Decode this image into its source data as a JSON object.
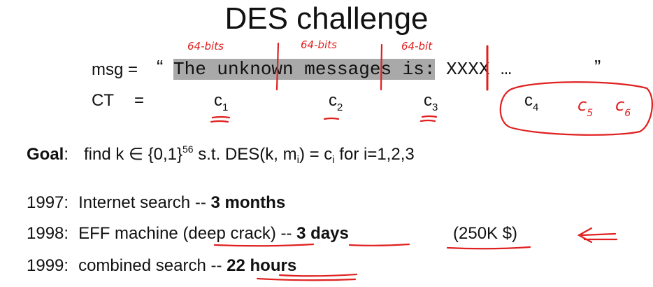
{
  "title": "DES challenge",
  "msg": {
    "label": "msg =",
    "open_quote": "“",
    "highlighted_text": "The unknown messages is:",
    "rest_text": " XXXX … ",
    "close_quote": "”"
  },
  "ct": {
    "label": "CT",
    "eq": "=",
    "blocks": [
      {
        "letter": "c",
        "sub": "1"
      },
      {
        "letter": "c",
        "sub": "2"
      },
      {
        "letter": "c",
        "sub": "3"
      },
      {
        "letter": "c",
        "sub": "4"
      }
    ]
  },
  "goal": {
    "label": "Goal",
    "colon": ":",
    "text1": "find   k ∈ {0,1}",
    "sup": "56",
    "text2": "   s.t.   DES(k, m",
    "sub_i": "i",
    "text3": ") = c",
    "sub_i2": "i",
    "text4": "   for  i=1,2,3"
  },
  "history": [
    {
      "year": "1997:",
      "desc": "Internet search  --  ",
      "result": "3 months",
      "extra": ""
    },
    {
      "year": "1998:",
      "desc": "EFF machine (deep crack)  --  ",
      "result": "3 days",
      "extra": "(250K $)"
    },
    {
      "year": "1999:",
      "desc": "combined search  --  ",
      "result": "22 hours",
      "extra": ""
    }
  ],
  "annotations": {
    "block_labels": [
      "64-bits",
      "64-bits",
      "64-bit"
    ],
    "c5": "c",
    "c5_sub": "5",
    "c6": "c",
    "c6_sub": "6",
    "ink_color": "#e02020"
  }
}
